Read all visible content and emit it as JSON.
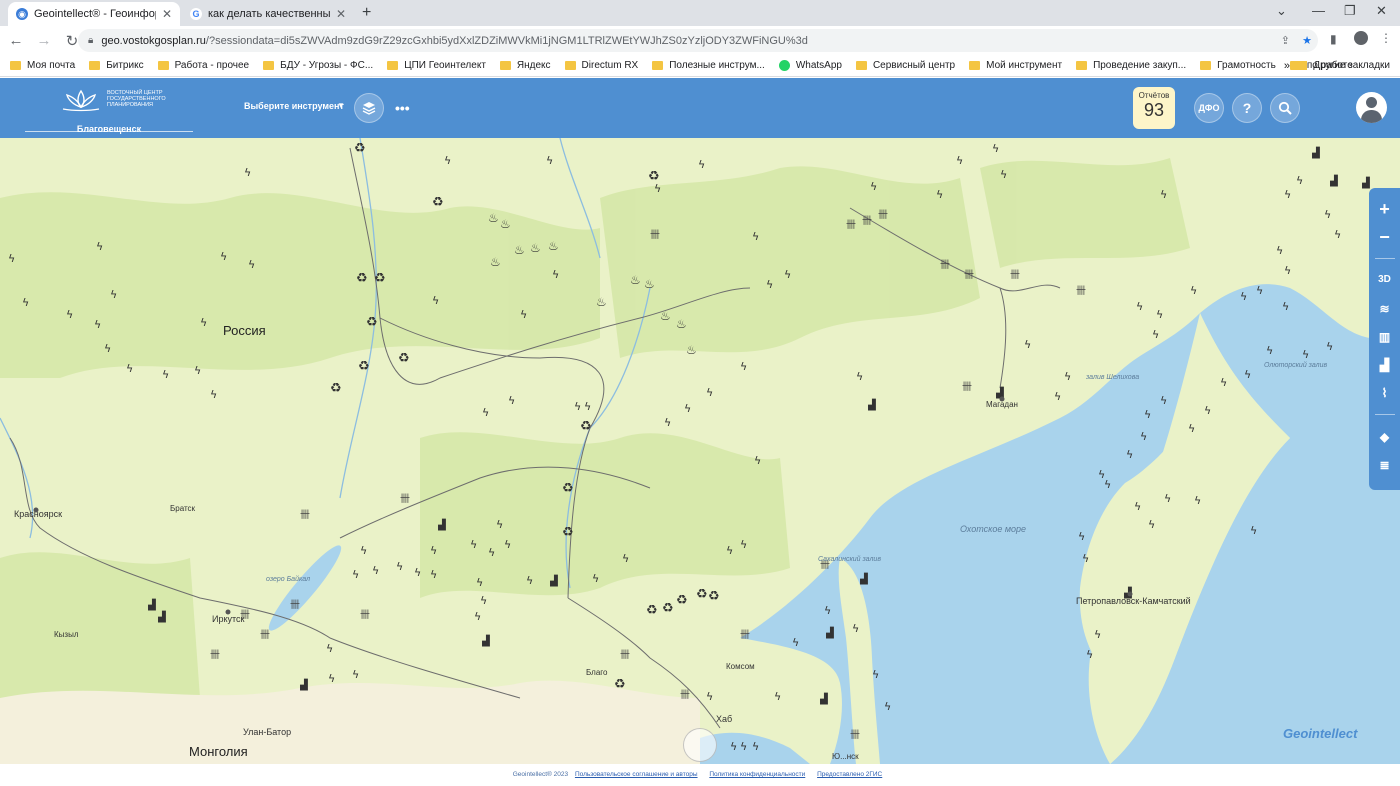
{
  "browser": {
    "tabs": [
      {
        "title": "Geointellect® - Геоинформаци",
        "active": true
      },
      {
        "title": "как делать качественные сним",
        "active": false
      }
    ],
    "address": {
      "domain": "geo.vostokgosplan.ru",
      "path": "/?sessiondata=di5sZWVAdm9zdG9rZ29zcGxhbi5ydXxlZDZiMWVkMi1jNGM1LTRlZWEtYWJhZS0zYzljODY3ZWFiNGU%3d"
    },
    "bookmarks": [
      "Моя почта",
      "Битрикс",
      "Работа - прочее",
      "БДУ - Угрозы - ФС...",
      "ЦПИ Геоинтелект",
      "Яндекс",
      "Directum RX",
      "Полезные инструм...",
      "WhatsApp",
      "Сервисный центр",
      "Мой инструмент",
      "Проведение закуп...",
      "Грамотность",
      "по работе"
    ],
    "other_bookmarks": "Другие закладки",
    "overflow": "»"
  },
  "app": {
    "logo_text": "ВОСТОЧНЫЙ ЦЕНТР ГОСУДАРСТВЕННОГО ПЛАНИРОВАНИЯ",
    "city": "Благовещенск",
    "tool_select": "Выберите инструмент",
    "reports_label": "Отчётов",
    "reports_count": "93",
    "dfo_label": "ДФО",
    "help_label": "?"
  },
  "map": {
    "labels": {
      "russia": "Россия",
      "mongolia": "Монголия",
      "okhotsk": "Охотское море",
      "shelikhov": "залив Шелихова",
      "krasnoyarsk": "Красноярск",
      "bratsk": "Братск",
      "irkutsk": "Иркутск",
      "kyzyl": "Кызыл",
      "ulanbator": "Улан-Батор",
      "magadan": "Магадан",
      "petropavlovsk": "Петропавловск-Камчатский",
      "blagoveshchensk": "Благо",
      "komsomolsk": "Комсом",
      "khabarovsk": "Хаб",
      "sakhalinsk": "Ю...нск",
      "baikal": "озеро Байкал",
      "sakhalin_bay": "Сахалинский залив",
      "olyutor": "Олюторский залив"
    }
  },
  "right_toolbar": {
    "zoom_in": "+",
    "zoom_out": "−",
    "view3d": "3D"
  },
  "watermark": "Geointellect",
  "footer": {
    "copyright": "Geointellect® 2023",
    "agreement": "Пользовательское соглашение и авторы",
    "privacy": "Политика конфиденциальности",
    "provided": "Предоставлено 2ГИС"
  }
}
